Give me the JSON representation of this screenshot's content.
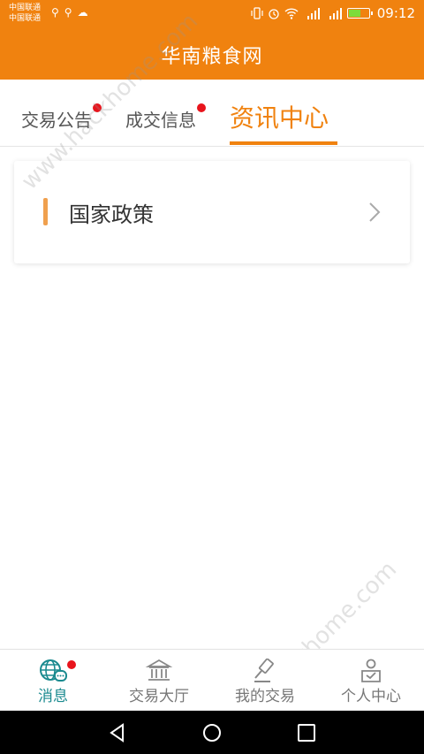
{
  "status_bar": {
    "carrier_1": "中国联通",
    "carrier_2": "中国联通",
    "time": "09:12",
    "battery_level": 0.6
  },
  "app_title": "华南粮食网",
  "tabs": [
    {
      "label": "交易公告",
      "has_dot": true
    },
    {
      "label": "成交信息",
      "has_dot": true
    },
    {
      "label": "资讯中心",
      "active": true
    }
  ],
  "card": {
    "label": "国家政策"
  },
  "bottom_nav": [
    {
      "label": "消息",
      "icon": "globe-chat-icon",
      "active": true,
      "has_dot": true
    },
    {
      "label": "交易大厅",
      "icon": "bank-building-icon"
    },
    {
      "label": "我的交易",
      "icon": "gavel-icon"
    },
    {
      "label": "个人中心",
      "icon": "person-icon"
    }
  ],
  "watermark": {
    "text_1": "www.hackhome.com",
    "text_2": "www.hackhome.com"
  },
  "colors": {
    "accent": "#f0820f",
    "active_nav": "#1a8a8f",
    "badge": "#e8141c"
  }
}
